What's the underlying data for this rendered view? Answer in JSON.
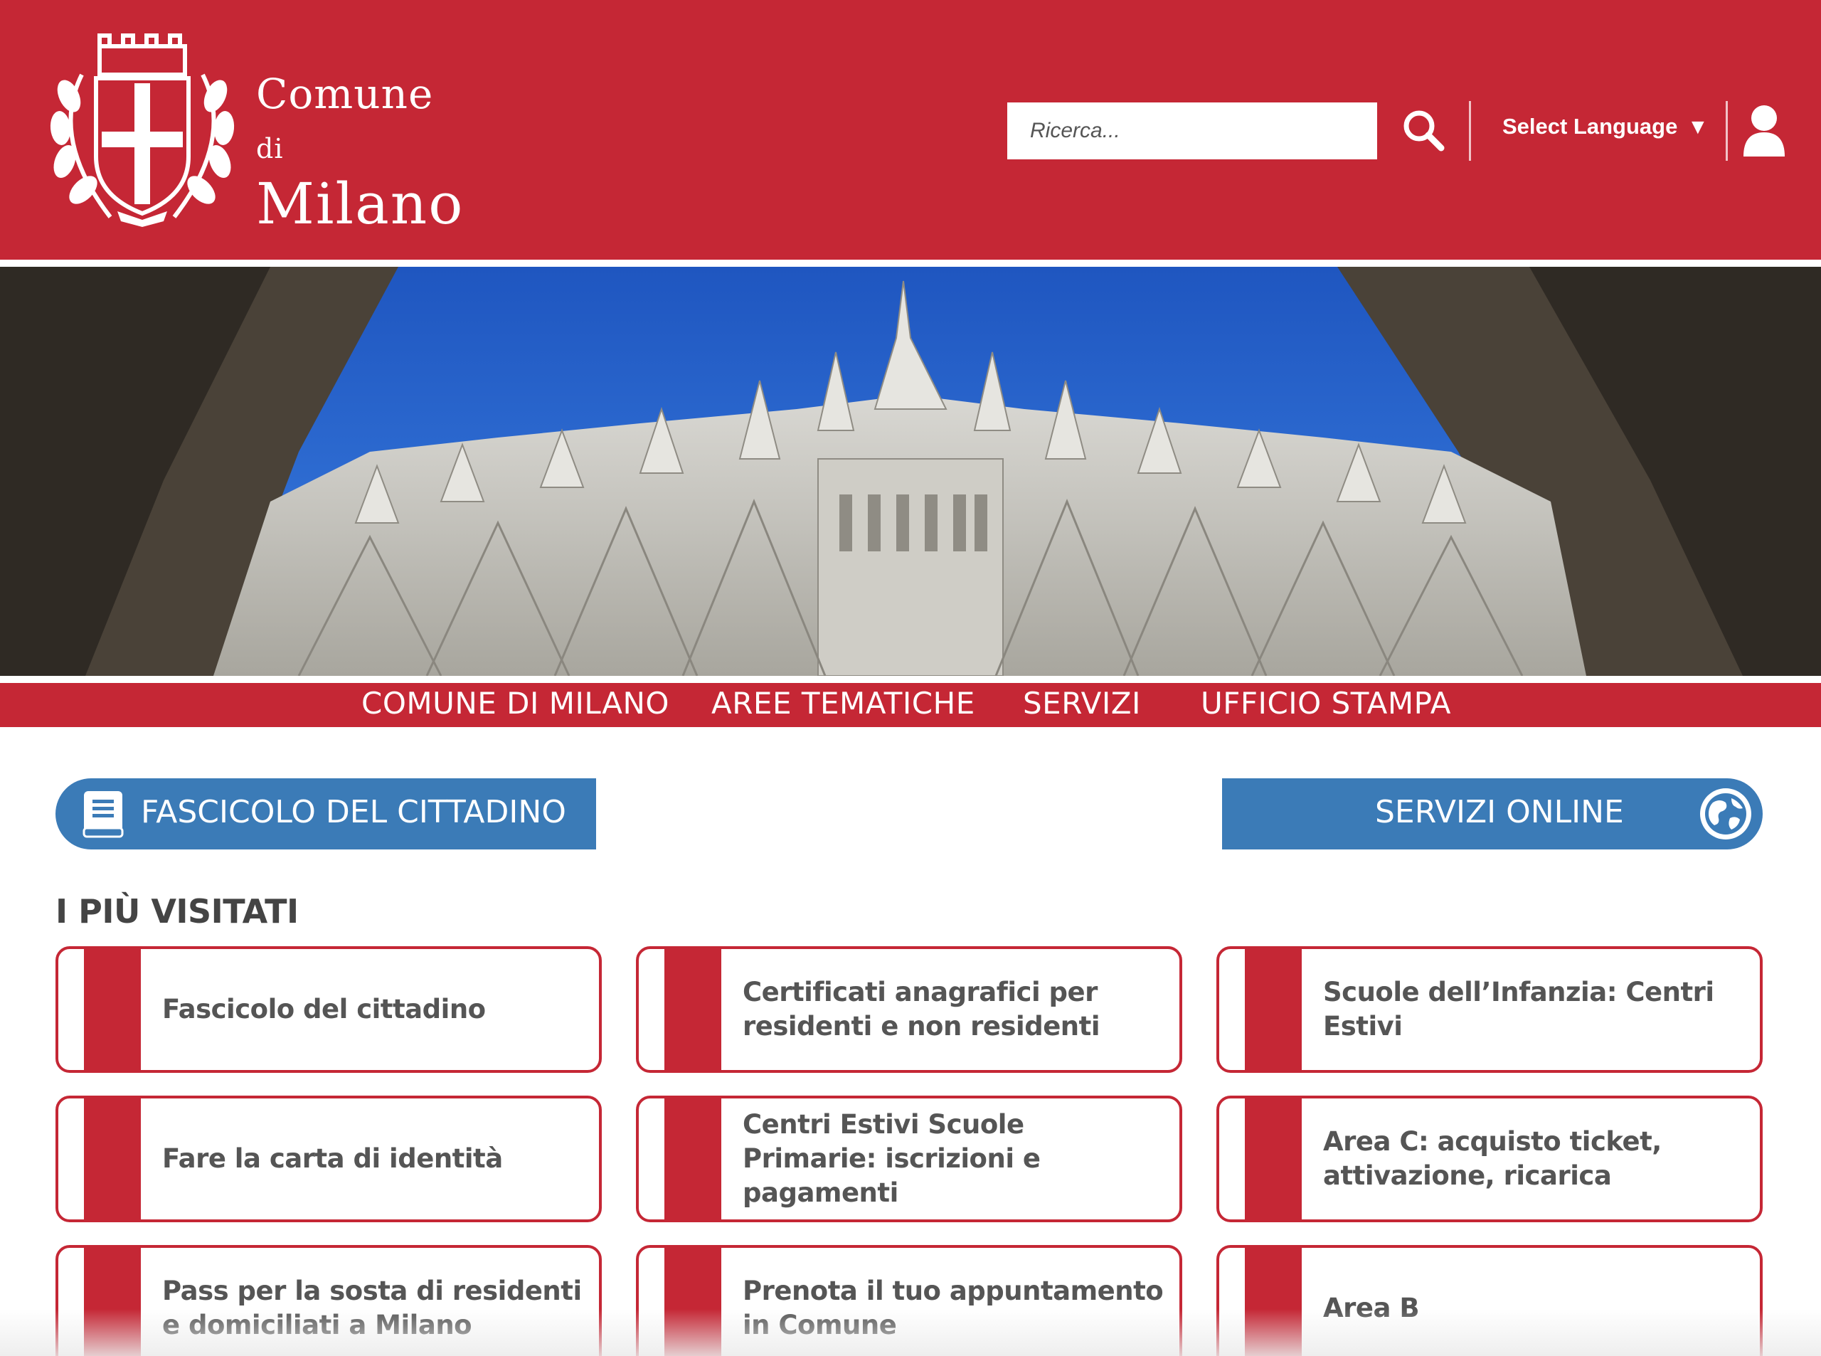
{
  "header": {
    "logo_line1": "Comune",
    "logo_di": "di",
    "logo_line2": "Milano",
    "search_placeholder": "Ricerca...",
    "language_label": "Select Language",
    "language_caret": "▼"
  },
  "nav": {
    "items": [
      {
        "label": "COMUNE DI MILANO"
      },
      {
        "label": "AREE TEMATICHE"
      },
      {
        "label": "SERVIZI"
      },
      {
        "label": "UFFICIO STAMPA"
      }
    ]
  },
  "actions": {
    "fascicolo_label": "FASCICOLO DEL CITTADINO",
    "servizi_online_label": "SERVIZI ONLINE"
  },
  "most_visited": {
    "title": "I PIÙ VISITATI",
    "items": [
      {
        "label": "Fascicolo del cittadino"
      },
      {
        "label": "Certificati anagrafici per residenti e non residenti"
      },
      {
        "label": "Scuole dell’Infanzia: Centri Estivi"
      },
      {
        "label": "Fare la carta di identità"
      },
      {
        "label": "Centri Estivi Scuole Primarie: iscrizioni e pagamenti"
      },
      {
        "label": "Area C: acquisto ticket, attivazione, ricarica"
      },
      {
        "label": "Pass per la sosta di residenti e domiciliati a Milano"
      },
      {
        "label": "Prenota il tuo appuntamento in Comune"
      },
      {
        "label": "Area B"
      }
    ]
  },
  "colors": {
    "brand_red": "#c52735",
    "accent_blue": "#3b7bb7",
    "sky_blue": "#2a63c6"
  }
}
